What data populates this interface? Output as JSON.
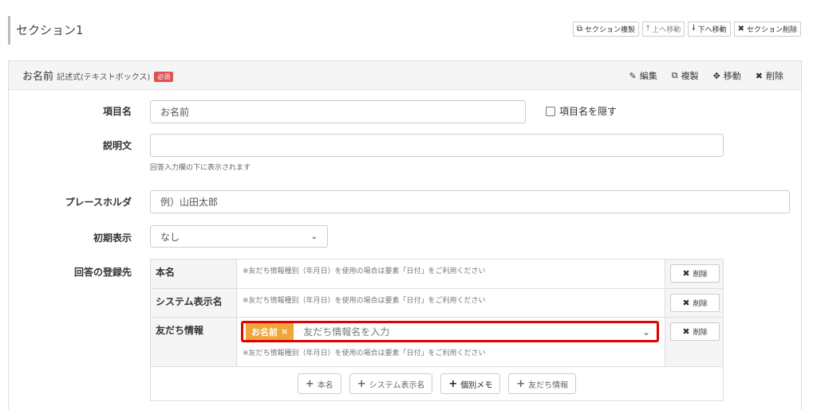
{
  "section": {
    "title": "セクション1",
    "actions": [
      {
        "icon": "⧉",
        "label": "セクション複製"
      },
      {
        "icon": "🠕",
        "label": "上へ移動"
      },
      {
        "icon": "🠗",
        "label": "下へ移動"
      },
      {
        "icon": "✖",
        "label": "セクション削除"
      }
    ]
  },
  "item": {
    "title": "お名前",
    "type": "記述式(テキストボックス)",
    "required_badge": "必須",
    "actions": {
      "edit": "編集",
      "duplicate": "複製",
      "move": "移動",
      "delete": "削除"
    }
  },
  "form": {
    "name_label": "項目名",
    "name_value": "お名前",
    "hide_label": "項目名を隠す",
    "desc_label": "説明文",
    "desc_value": "",
    "desc_help": "回答入力欄の下に表示されます",
    "placeholder_label": "プレースホルダ",
    "placeholder_value": "例）山田太郎",
    "initial_label": "初期表示",
    "initial_value": "なし",
    "dest_label": "回答の登録先"
  },
  "dest_rows": [
    {
      "key": "本名",
      "note": "※友だち情報種別（年月日）を使用の場合は要素「日付」をご利用ください",
      "delete": "削除"
    },
    {
      "key": "システム表示名",
      "note": "※友だち情報種別（年月日）を使用の場合は要素「日付」をご利用ください",
      "delete": "削除"
    },
    {
      "key": "友だち情報",
      "tag": "お名前",
      "tag_remove": "×",
      "input_placeholder": "友だち情報名を入力",
      "note": "※友だち情報種別（年月日）を使用の場合は要素「日付」をご利用ください",
      "delete": "削除"
    }
  ],
  "add_buttons": [
    {
      "label": "本名"
    },
    {
      "label": "システム表示名"
    },
    {
      "label": "個別メモ"
    },
    {
      "label": "友だち情報"
    }
  ],
  "icons": {
    "plus": "+",
    "times": "✖",
    "chevron": "⌄"
  },
  "colors": {
    "highlight": "#e00000",
    "tag": "#f0a53a",
    "required": "#e05252"
  }
}
